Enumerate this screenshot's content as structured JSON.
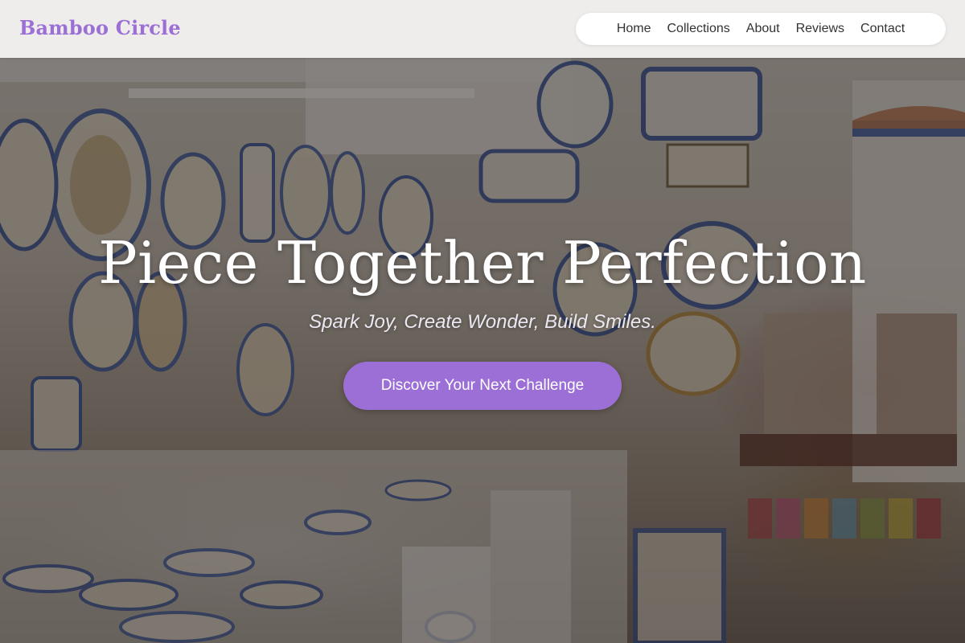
{
  "brand": {
    "name": "Bamboo Circle",
    "color": "#9b6fd6"
  },
  "nav": {
    "items": [
      {
        "label": "Home"
      },
      {
        "label": "Collections"
      },
      {
        "label": "About"
      },
      {
        "label": "Reviews"
      },
      {
        "label": "Contact"
      }
    ]
  },
  "hero": {
    "title": "Piece Together Perfection",
    "subtitle": "Spark Joy, Create Wonder, Build Smiles.",
    "cta_label": "Discover Your Next Challenge",
    "background_image": "Ceramics shop interior with blue and white painted plates on walls and shelves"
  },
  "colors": {
    "accent": "#9b6fd6",
    "header_bg": "#f8f6f4",
    "nav_text": "#333333",
    "hero_text": "#ffffff"
  }
}
